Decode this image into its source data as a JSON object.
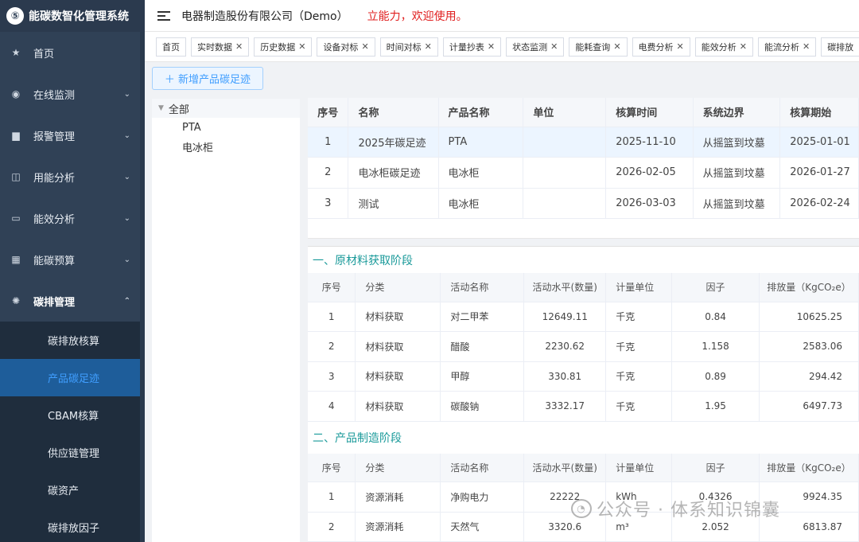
{
  "app": {
    "title": "能碳数智化管理系统",
    "logo_glyph": "⑤"
  },
  "header": {
    "company": "电器制造股份有限公司（Demo）",
    "welcome": "立能力，欢迎使用。"
  },
  "sidebar": {
    "items": [
      {
        "label": "首页",
        "icon": "star-icon"
      },
      {
        "label": "在线监测",
        "icon": "eye-icon"
      },
      {
        "label": "报警管理",
        "icon": "alarm-icon"
      },
      {
        "label": "用能分析",
        "icon": "book-icon"
      },
      {
        "label": "能效分析",
        "icon": "monitor-icon"
      },
      {
        "label": "能碳预算",
        "icon": "calendar-icon"
      },
      {
        "label": "碳排管理",
        "icon": "gear-icon"
      }
    ],
    "submenu": [
      "碳排放核算",
      "产品碳足迹",
      "CBAM核算",
      "供应链管理",
      "碳资产",
      "碳排放因子"
    ],
    "active_sub": "产品碳足迹"
  },
  "tags": [
    "首页",
    "实时数据",
    "历史数据",
    "设备对标",
    "时间对标",
    "计量抄表",
    "状态监测",
    "能耗查询",
    "电费分析",
    "能效分析",
    "能流分析",
    "碳排放"
  ],
  "toolbar": {
    "add_label": "＋ 新增产品碳足迹"
  },
  "tree": {
    "root": "全部",
    "children": [
      "PTA",
      "电冰柜"
    ]
  },
  "product_table": {
    "headers": [
      "序号",
      "名称",
      "产品名称",
      "单位",
      "核算时间",
      "系统边界",
      "核算期始"
    ],
    "rows": [
      [
        "1",
        "2025年碳足迹",
        "PTA",
        "",
        "2025-11-10",
        "从摇篮到坟墓",
        "2025-01-01"
      ],
      [
        "2",
        "电冰柜碳足迹",
        "电冰柜",
        "",
        "2026-02-05",
        "从摇篮到坟墓",
        "2026-01-27"
      ],
      [
        "3",
        "测试",
        "电冰柜",
        "",
        "2026-03-03",
        "从摇篮到坟墓",
        "2026-02-24"
      ]
    ]
  },
  "section1": {
    "title": "一、原材料获取阶段",
    "headers": [
      "序号",
      "分类",
      "活动名称",
      "活动水平(数量)",
      "计量单位",
      "因子",
      "排放量（KgCO₂e）"
    ],
    "rows": [
      [
        "1",
        "材料获取",
        "对二甲苯",
        "12649.11",
        "千克",
        "0.84",
        "10625.25"
      ],
      [
        "2",
        "材料获取",
        "醋酸",
        "2230.62",
        "千克",
        "1.158",
        "2583.06"
      ],
      [
        "3",
        "材料获取",
        "甲醇",
        "330.81",
        "千克",
        "0.89",
        "294.42"
      ],
      [
        "4",
        "材料获取",
        "碳酸钠",
        "3332.17",
        "千克",
        "1.95",
        "6497.73"
      ]
    ]
  },
  "section2": {
    "title": "二、产品制造阶段",
    "headers": [
      "序号",
      "分类",
      "活动名称",
      "活动水平(数量)",
      "计量单位",
      "因子",
      "排放量（KgCO₂e）"
    ],
    "rows": [
      [
        "1",
        "资源消耗",
        "净购电力",
        "22222",
        "kWh",
        "0.4326",
        "9924.35"
      ],
      [
        "2",
        "资源消耗",
        "天然气",
        "3320.6",
        "m³",
        "2.052",
        "6813.87"
      ]
    ]
  },
  "watermark": {
    "text": "公众号 · 体系知识锦囊"
  }
}
